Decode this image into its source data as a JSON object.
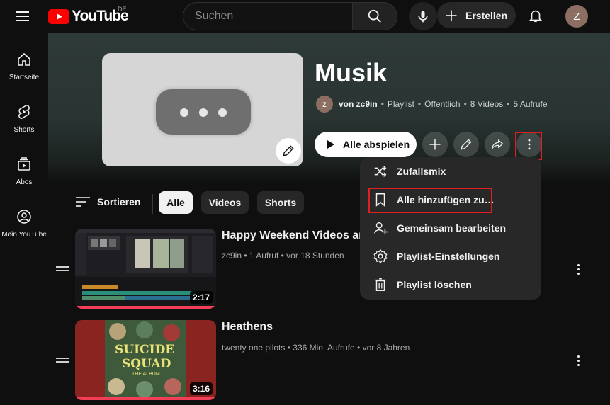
{
  "topbar": {
    "logo_text": "YouTube",
    "region": "DE",
    "search_placeholder": "Suchen",
    "create_label": "Erstellen",
    "avatar_letter": "Z"
  },
  "sidebar": {
    "items": [
      {
        "label": "Startseite",
        "icon": "home-icon"
      },
      {
        "label": "Shorts",
        "icon": "shorts-icon"
      },
      {
        "label": "Abos",
        "icon": "subscriptions-icon"
      },
      {
        "label": "Mein YouTube",
        "icon": "account-icon"
      }
    ]
  },
  "playlist": {
    "title": "Musik",
    "owner_avatar": "z",
    "owner": "von zc9in",
    "type": "Playlist",
    "visibility": "Öffentlich",
    "video_count": "8 Videos",
    "views": "5 Aufrufe",
    "play_all_label": "Alle abspielen"
  },
  "filters": {
    "sort_label": "Sortieren",
    "chips": [
      "Alle",
      "Videos",
      "Shorts"
    ],
    "active": "Alle"
  },
  "videos": [
    {
      "title": "Happy Weekend Videos and",
      "channel": "zc9in",
      "views": "1 Aufruf",
      "age": "vor 18 Stunden",
      "duration": "2:17"
    },
    {
      "title": "Heathens",
      "channel": "twenty one pilots",
      "views": "336 Mio. Aufrufe",
      "age": "vor 8 Jahren",
      "duration": "3:16",
      "thumb_text_1": "SUICIDE",
      "thumb_text_2": "SQUAD",
      "thumb_text_3": "THE ALBUM"
    }
  ],
  "menu": {
    "items": [
      {
        "label": "Zufallsmix",
        "icon": "shuffle-icon"
      },
      {
        "label": "Alle hinzufügen zu…",
        "icon": "bookmark-icon"
      },
      {
        "label": "Gemeinsam bearbeiten",
        "icon": "collaborate-icon"
      },
      {
        "label": "Playlist-Einstellungen",
        "icon": "settings-icon"
      },
      {
        "label": "Playlist löschen",
        "icon": "trash-icon"
      }
    ]
  },
  "colors": {
    "brand_red": "#ff0000",
    "highlight_border": "#e02020",
    "progress": "#f23e57"
  }
}
